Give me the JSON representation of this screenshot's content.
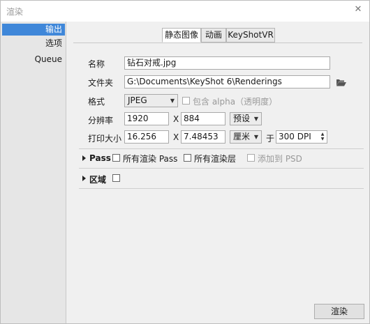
{
  "window": {
    "title": "渲染",
    "close_glyph": "✕"
  },
  "sidebar": {
    "items": [
      {
        "label": "输出",
        "active": true
      },
      {
        "label": "选项",
        "active": false
      },
      {
        "label": "Queue",
        "active": false
      }
    ]
  },
  "tabs": [
    {
      "label": "静态图像",
      "active": true
    },
    {
      "label": "动画",
      "active": false
    },
    {
      "label": "KeyShotVR",
      "active": false
    }
  ],
  "form": {
    "name_label": "名称",
    "name_value": "钻石对戒.jpg",
    "folder_label": "文件夹",
    "folder_value": "G:\\Documents\\KeyShot 6\\Renderings",
    "folder_icon": "folder-open-icon",
    "format_label": "格式",
    "format_value": "JPEG",
    "alpha_label": "包含 alpha（透明度）",
    "alpha_checked": false,
    "resolution_label": "分辨率",
    "res_width": "1920",
    "res_x": "X",
    "res_height": "884",
    "preset_label": "预设",
    "print_label": "打印大小",
    "print_width": "16.256",
    "print_x": "X",
    "print_height": "7.48453",
    "unit_value": "厘米",
    "at_label": "于",
    "dpi_value": "300 DPI"
  },
  "pass": {
    "label": "Pass",
    "all_passes_label": "所有渲染 Pass",
    "all_layers_label": "所有渲染层",
    "add_psd_label": "添加到 PSD"
  },
  "region": {
    "label": "区域"
  },
  "footer": {
    "render_button": "渲染"
  }
}
